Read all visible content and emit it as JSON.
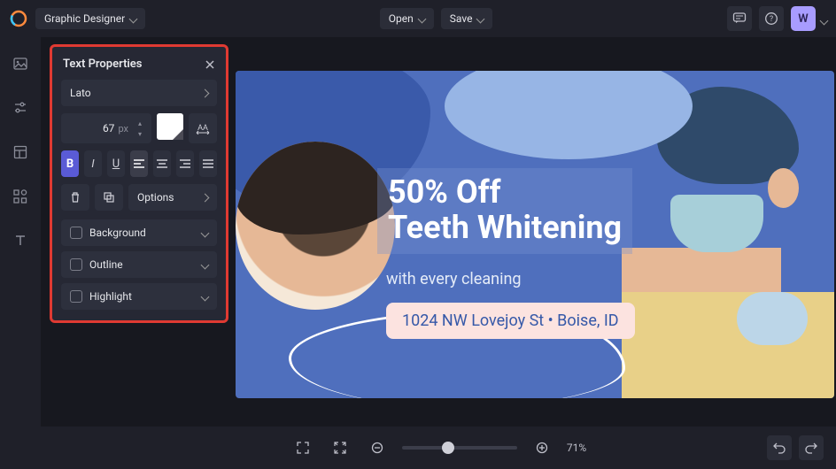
{
  "top": {
    "mode": "Graphic Designer",
    "open": "Open",
    "save": "Save",
    "avatar_letter": "W"
  },
  "panel": {
    "title": "Text Properties",
    "font": "Lato",
    "size": "67",
    "unit": "px",
    "options": "Options",
    "background": "Background",
    "outline": "Outline",
    "highlight": "Highlight"
  },
  "canvas": {
    "headline_1": "50% Off",
    "headline_2": "Teeth Whitening",
    "subhead": "with every cleaning",
    "address": "1024 NW Lovejoy St • Boise, ID"
  },
  "bottom": {
    "zoom_pct": "71%"
  }
}
